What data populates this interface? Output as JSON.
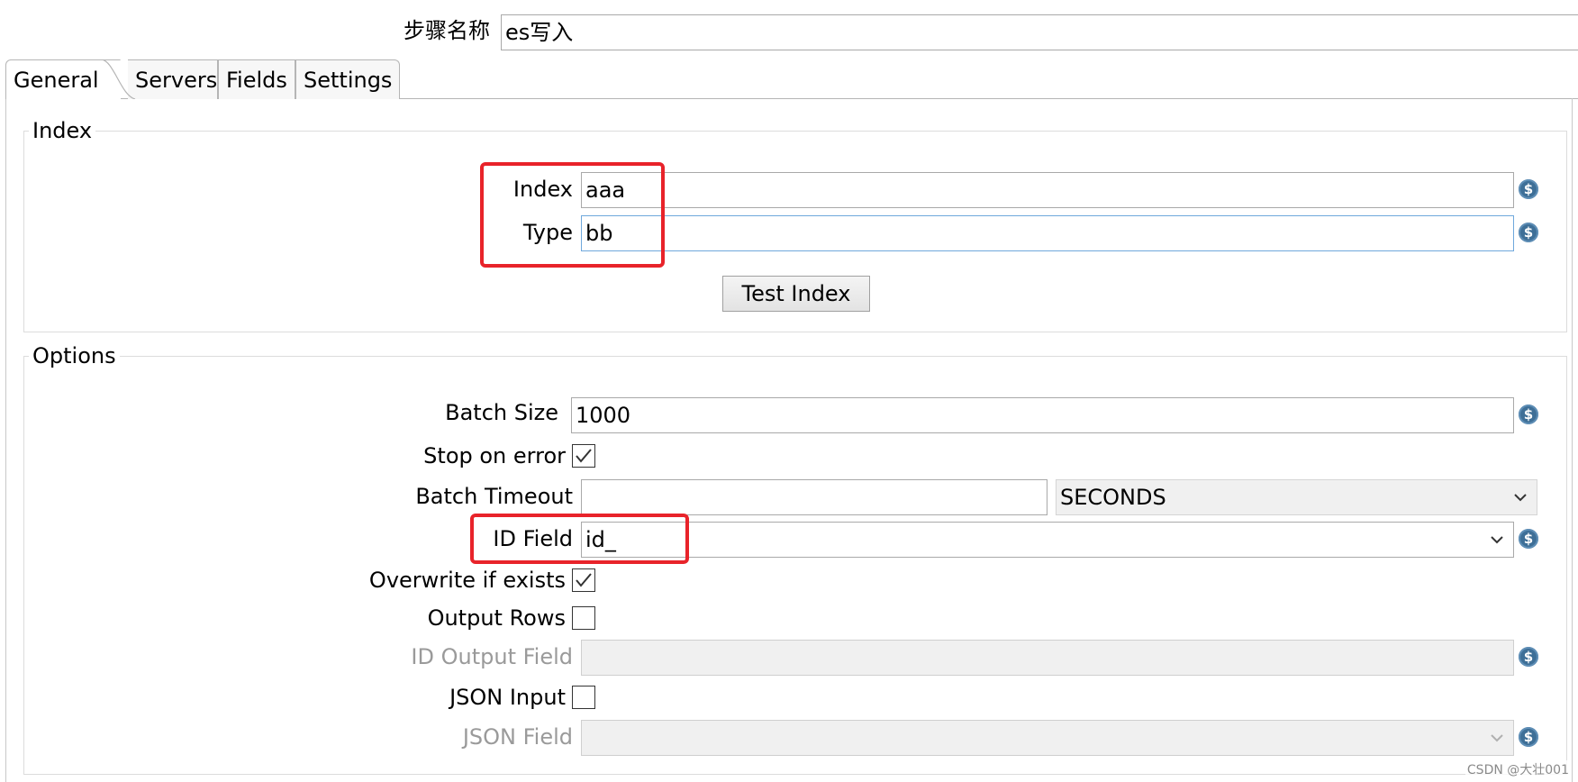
{
  "header": {
    "step_name_label": "步骤名称",
    "step_name_value": "es写入"
  },
  "tabs": [
    {
      "label": "General",
      "active": true
    },
    {
      "label": "Servers",
      "active": false
    },
    {
      "label": "Fields",
      "active": false
    },
    {
      "label": "Settings",
      "active": false
    }
  ],
  "index_group": {
    "title": "Index",
    "index_label": "Index",
    "index_value": "aaa",
    "type_label": "Type",
    "type_value": "bb",
    "test_button": "Test Index"
  },
  "options_group": {
    "title": "Options",
    "batch_size_label": "Batch Size",
    "batch_size_value": "1000",
    "stop_on_error_label": "Stop on error",
    "stop_on_error_checked": true,
    "batch_timeout_label": "Batch Timeout",
    "batch_timeout_value": "",
    "batch_timeout_unit": "SECONDS",
    "id_field_label": "ID Field",
    "id_field_value": "id_",
    "overwrite_label": "Overwrite if exists",
    "overwrite_checked": true,
    "output_rows_label": "Output Rows",
    "output_rows_checked": false,
    "id_output_field_label": "ID Output Field",
    "id_output_field_value": "",
    "json_input_label": "JSON Input",
    "json_input_checked": false,
    "json_field_label": "JSON Field",
    "json_field_value": ""
  },
  "icons": {
    "variable": "variable-dollar-icon",
    "check": "checkmark-icon",
    "dropdown": "chevron-down-icon"
  },
  "colors": {
    "highlight": "#e8232a",
    "variable_icon": "#3e6f97",
    "focus_border": "#6fa8dc"
  },
  "watermark": "CSDN @大壮001"
}
